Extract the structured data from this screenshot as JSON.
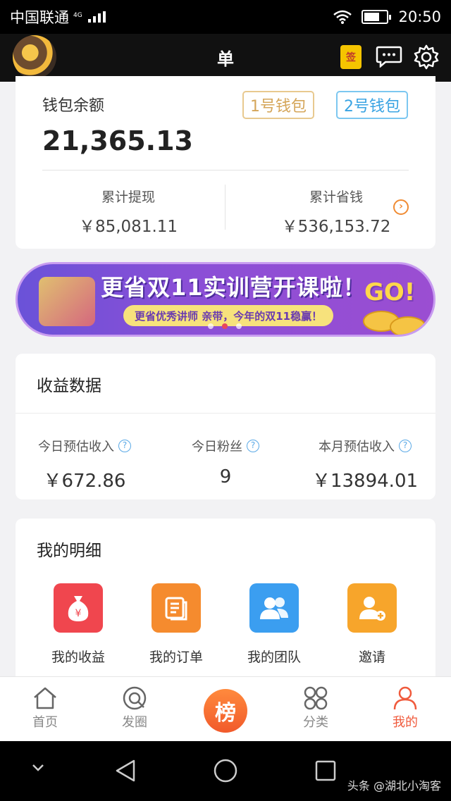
{
  "status": {
    "carrier": "中国联通",
    "network": "4G",
    "time": "20:50"
  },
  "header": {
    "title": "单",
    "signin_label": "签"
  },
  "wallet": {
    "label": "钱包余额",
    "balance": "21,365.13",
    "wallet1": "1号钱包",
    "wallet2": "2号钱包",
    "withdrawn_label": "累计提现",
    "withdrawn_value": "￥85,081.11",
    "saved_label": "累计省钱",
    "saved_value": "￥536,153.72"
  },
  "banner": {
    "headline": "更省双11实训营开课啦！",
    "sub": "更省优秀讲师 亲带，今年的双11稳赢！",
    "go": "GO!"
  },
  "earnings": {
    "title": "收益数据",
    "cols": [
      {
        "label": "今日预估收入",
        "value": "￥672.86"
      },
      {
        "label": "今日粉丝",
        "value": "9"
      },
      {
        "label": "本月预估收入",
        "value": "￥13894.01"
      }
    ]
  },
  "detail": {
    "title": "我的明细",
    "items": [
      {
        "label": "我的收益",
        "icon": "money-bag-icon",
        "color": "#f0464e"
      },
      {
        "label": "我的订单",
        "icon": "order-icon",
        "color": "#f58b2e"
      },
      {
        "label": "我的团队",
        "icon": "team-icon",
        "color": "#3b9ef0"
      },
      {
        "label": "邀请",
        "icon": "invite-icon",
        "color": "#f7a52b"
      }
    ]
  },
  "nav": {
    "items": [
      "首页",
      "发圈",
      "分类",
      "我的"
    ],
    "center_label": "榜",
    "active": "我的",
    "accent": "#f05a3c"
  },
  "watermark": "头条 @湖北小淘客"
}
